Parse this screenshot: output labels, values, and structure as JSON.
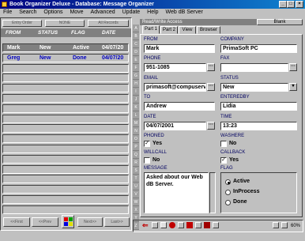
{
  "window": {
    "title": "Book Organizer Deluxe - Database: Message Organizer"
  },
  "menu": [
    "File",
    "Search",
    "Options",
    "Move",
    "Advanced",
    "Update",
    "Help",
    "Web dB Server"
  ],
  "left_toolbar": [
    "Entry Order",
    "NONE",
    "All Records"
  ],
  "list": {
    "columns": [
      "FROM",
      "STATUS",
      "FLAG",
      "DATE"
    ],
    "rows": [
      {
        "from": "Mark",
        "status": "New",
        "flag": "Active",
        "date": "04/07/20"
      },
      {
        "from": "Greg",
        "status": "New",
        "flag": "Done",
        "date": "04/07/20"
      }
    ]
  },
  "nav_buttons": [
    "<<First",
    "<<Prev",
    "Next>>",
    "Last>>"
  ],
  "right_header": {
    "title": "Read/Write Access",
    "blank_label": "Blank"
  },
  "tabs": [
    "Part 1",
    "Part 2",
    "View",
    "Browser"
  ],
  "letters": [
    "A",
    "B",
    "C",
    "D",
    "E",
    "F",
    "G",
    "H",
    "I",
    "J",
    "K",
    "L",
    "M",
    "N",
    "O",
    "P",
    "Q",
    "R",
    "S",
    "T",
    "U",
    "V",
    "W",
    "X",
    "Y",
    "Z"
  ],
  "form": {
    "from_label": "FROM",
    "from": "Mark",
    "company_label": "COMPANY",
    "company": "PrimaSoft PC",
    "phone_label": "PHONE",
    "phone": "951-1085",
    "fax_label": "FAX",
    "fax": "",
    "email_label": "EMAIL",
    "email": "primasoft@compuserv",
    "status_label": "STATUS",
    "status": "New",
    "to_label": "TO",
    "to": "Andrew",
    "enteredby_label": "ENTEREDBY",
    "enteredby": "Lidia",
    "date_label": "DATE",
    "date": "04/07/2001",
    "time_label": "TIME",
    "time": "13:23",
    "phoned_label": "PHONED",
    "phoned_text": "Yes",
    "phoned": true,
    "washere_label": "WASHERE",
    "washere_text": "No",
    "washere": false,
    "willcall_label": "WILLCALL",
    "willcall_text": "No",
    "willcall": false,
    "callback_label": "CALLBACK",
    "callback_text": "Yes",
    "callback": true,
    "message_label": "MESSAGE",
    "message": "Asked about our Web dB Server.",
    "flag_label": "FLAG",
    "flag_options": [
      "Active",
      "InProcess",
      "Done"
    ],
    "flag_selected": "Active"
  },
  "zoom": "60%",
  "colors": {
    "titlebar": "#000080",
    "list_text": "#0000c0",
    "selected_row": "#808080"
  }
}
